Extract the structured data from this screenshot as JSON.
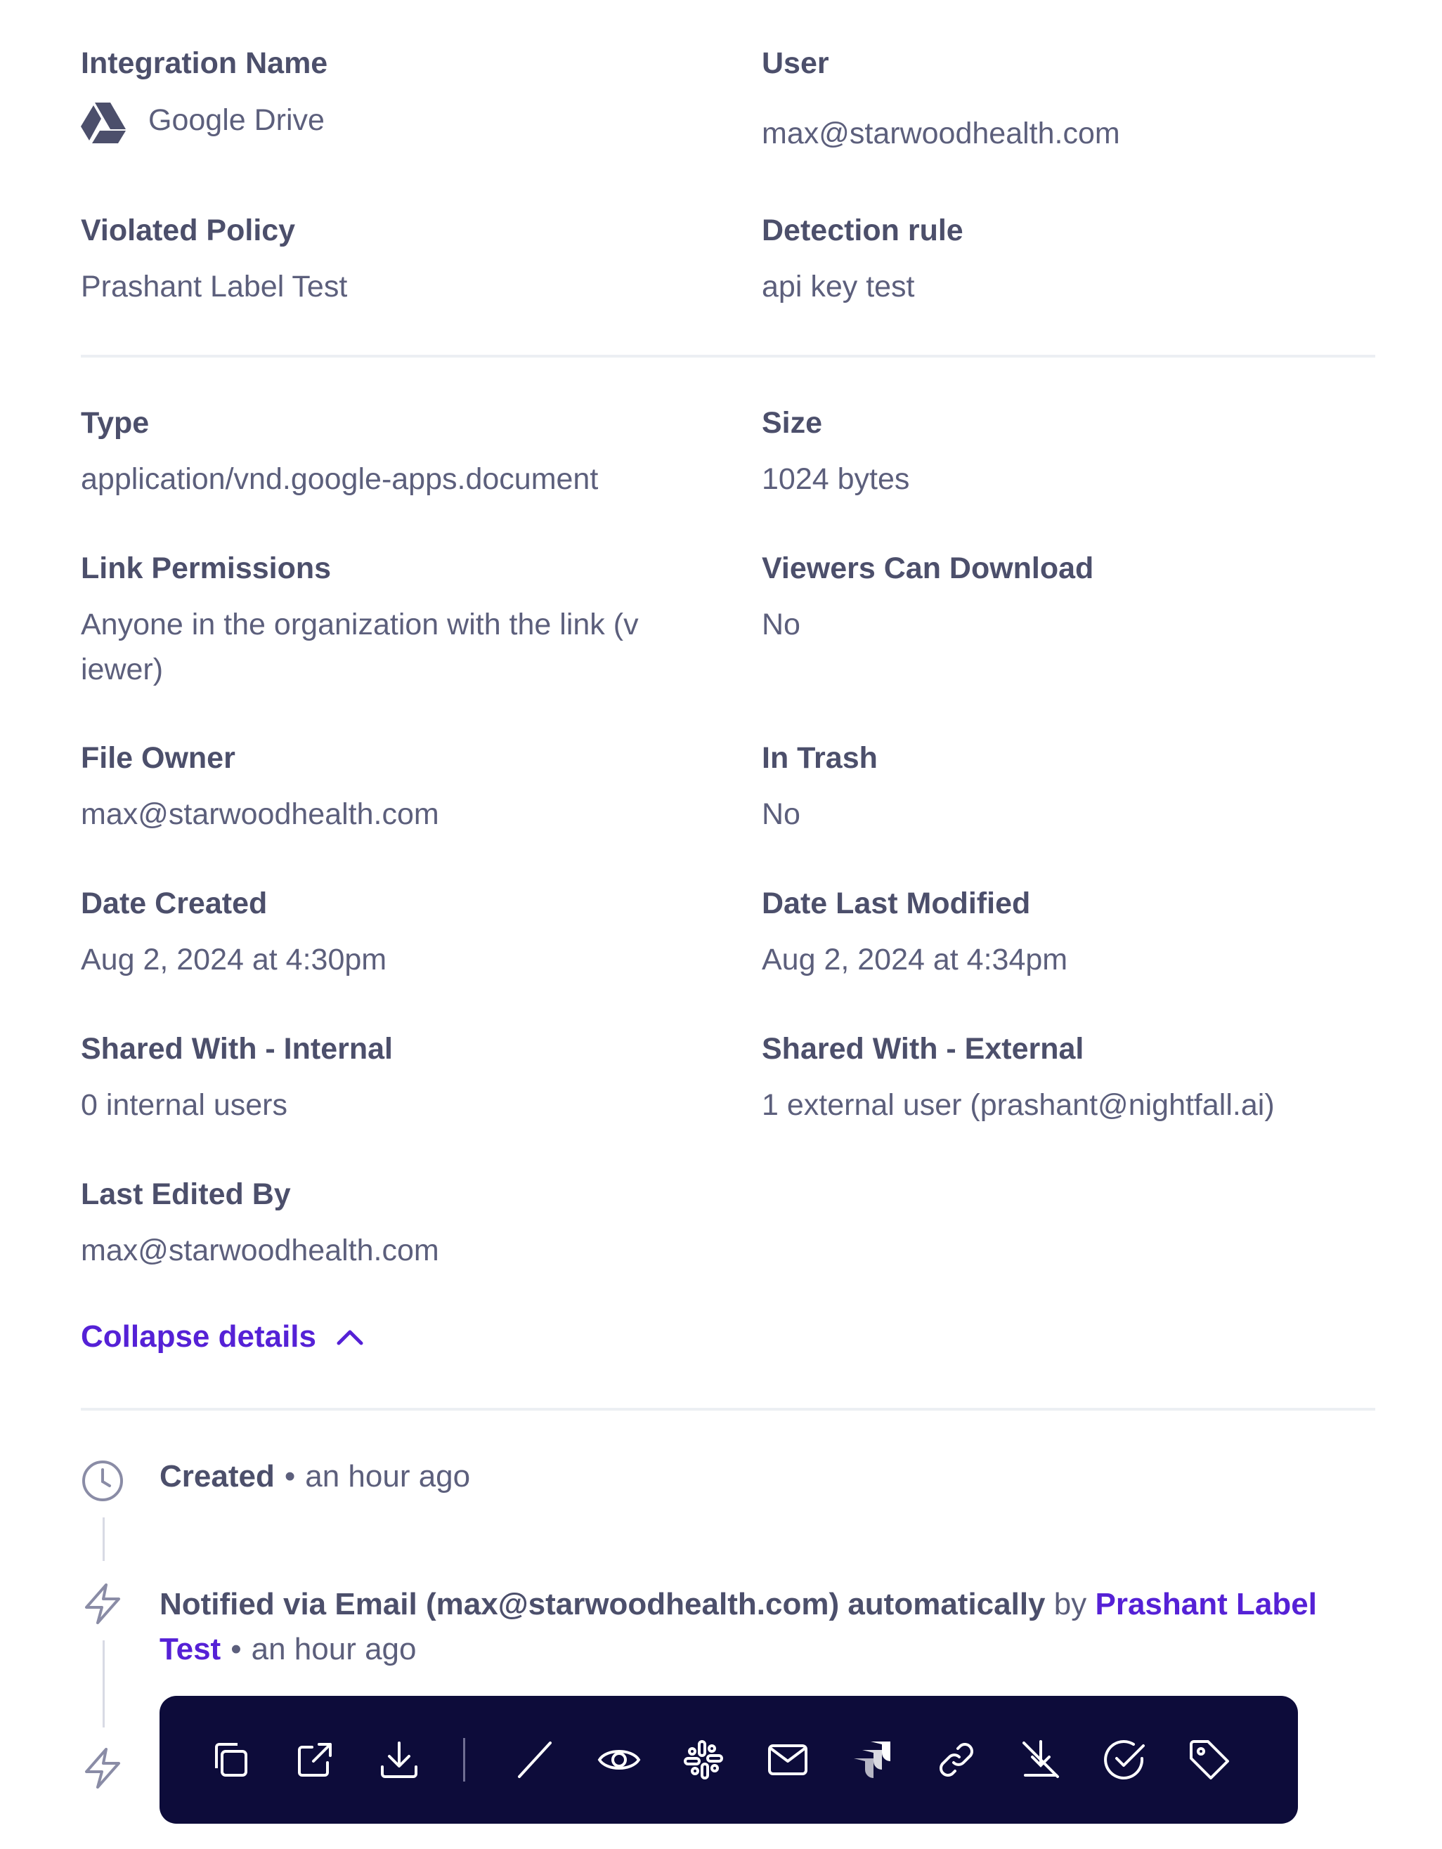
{
  "details": {
    "integration_label": "Integration Name",
    "integration_value": "Google Drive",
    "user_label": "User",
    "user_value": "max@starwoodhealth.com",
    "violated_policy_label": "Violated Policy",
    "violated_policy_value": "Prashant Label Test",
    "detection_rule_label": "Detection rule",
    "detection_rule_value": "api key test",
    "type_label": "Type",
    "type_value": "application/vnd.google-apps.document",
    "size_label": "Size",
    "size_value": "1024 bytes",
    "link_permissions_label": "Link Permissions",
    "link_permissions_value": "Anyone in the organization with the link (v iewer)",
    "viewers_download_label": "Viewers Can Download",
    "viewers_download_value": "No",
    "file_owner_label": "File Owner",
    "file_owner_value": "max@starwoodhealth.com",
    "in_trash_label": "In Trash",
    "in_trash_value": "No",
    "date_created_label": "Date Created",
    "date_created_value": "Aug 2, 2024 at 4:30pm",
    "date_modified_label": "Date Last Modified",
    "date_modified_value": "Aug 2, 2024 at 4:34pm",
    "shared_internal_label": "Shared With - Internal",
    "shared_internal_value": "0 internal users",
    "shared_external_label": "Shared With - External",
    "shared_external_value": "1 external user (prashant@nightfall.ai)",
    "last_edited_label": "Last Edited By",
    "last_edited_value": "max@starwoodhealth.com",
    "collapse_label": "Collapse details"
  },
  "timeline": {
    "created_title": "Created",
    "created_time": "an hour ago",
    "notified_title": "Notified via Email (max@starwoodhealth.com) automatically",
    "notified_by": "by",
    "notified_policy": "Prashant Label Test",
    "notified_time": "an hour ago",
    "separator": "•"
  },
  "toolbar_icons": [
    "copy-icon",
    "open-external-icon",
    "download-icon",
    "divider",
    "slash-icon",
    "eye-icon",
    "slack-icon",
    "mail-icon",
    "jira-icon",
    "link-icon",
    "disable-sharing-icon",
    "resolve-icon",
    "tag-icon"
  ],
  "colors": {
    "accent": "#5521d6",
    "toolbar_bg": "#0d0c3a",
    "text": "#5c5f7c",
    "label": "#4c4f6b"
  }
}
